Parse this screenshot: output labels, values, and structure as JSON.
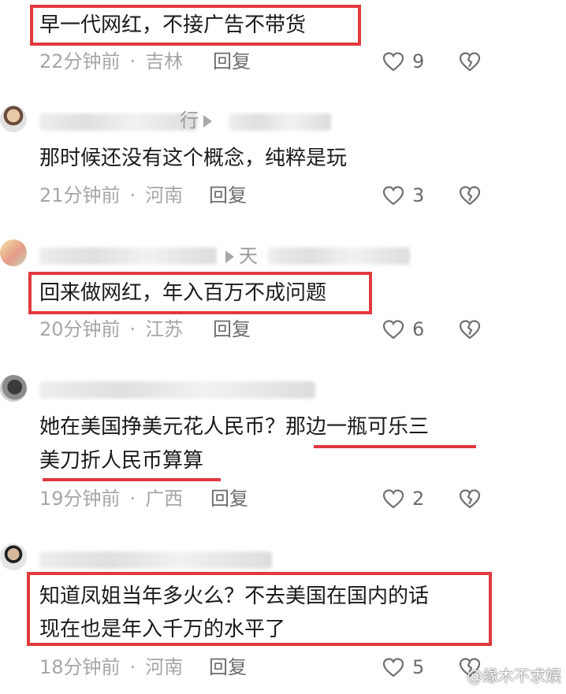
{
  "comments": [
    {
      "text_lines": [
        "早一代网红，不接广告不带货"
      ],
      "time": "22分钟前",
      "location": "吉林",
      "reply_label": "回复",
      "likes": "9"
    },
    {
      "name_suffix": "行",
      "text_lines": [
        "那时候还没有这个概念，纯粹是玩"
      ],
      "time": "21分钟前",
      "location": "河南",
      "reply_label": "回复",
      "likes": "3"
    },
    {
      "name_suffix": "天",
      "text_lines": [
        "回来做网红，年入百万不成问题"
      ],
      "time": "20分钟前",
      "location": "江苏",
      "reply_label": "回复",
      "likes": "6"
    },
    {
      "text_lines": [
        "她在美国挣美元花人民币？那边一瓶可乐三",
        "美刀折人民币算算"
      ],
      "time": "19分钟前",
      "location": "广西",
      "reply_label": "回复",
      "likes": "2"
    },
    {
      "text_lines": [
        "知道凤姐当年多火么？不去美国在国内的话",
        "现在也是年入千万的水平了"
      ],
      "time": "18分钟前",
      "location": "河南",
      "reply_label": "回复",
      "likes": "5"
    }
  ],
  "watermark": "@缘木不求娱",
  "colors": {
    "highlight": "#e0393e",
    "meta": "#a6a6a6",
    "text": "#1a1a1a"
  },
  "icons": {
    "like": "heart-outline-icon",
    "dislike": "broken-heart-icon",
    "separator": "play-arrow-icon"
  }
}
